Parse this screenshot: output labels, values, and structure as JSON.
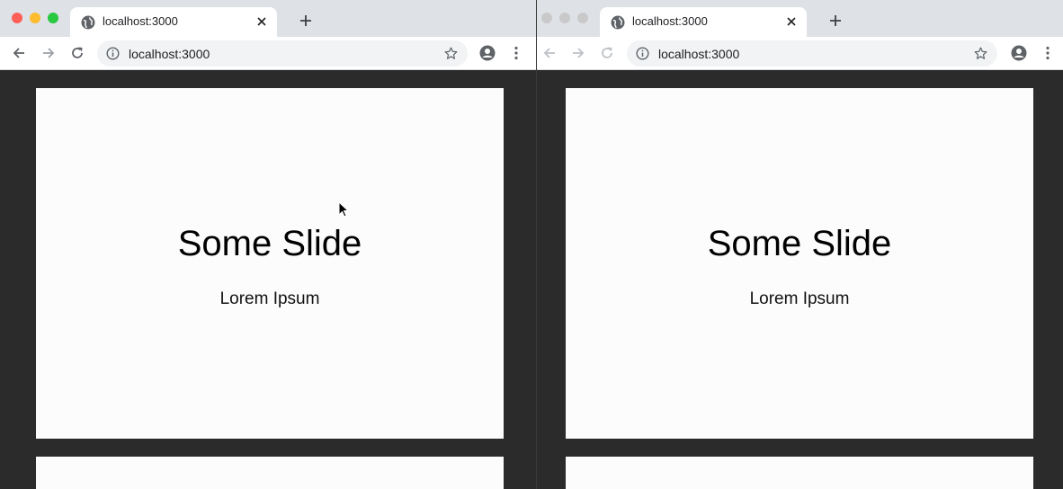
{
  "windows": [
    {
      "tab": {
        "title": "localhost:3000"
      },
      "address": {
        "url": "localhost:3000"
      },
      "slides": [
        {
          "title": "Some Slide",
          "subtitle": "Lorem Ipsum"
        },
        {
          "title": "",
          "subtitle": ""
        }
      ],
      "traffic_lights": [
        "#ff5f57",
        "#febc2e",
        "#28c840"
      ]
    },
    {
      "tab": {
        "title": "localhost:3000"
      },
      "address": {
        "url": "localhost:3000"
      },
      "slides": [
        {
          "title": "Some Slide",
          "subtitle": "Lorem Ipsum"
        },
        {
          "title": "",
          "subtitle": ""
        }
      ],
      "traffic_lights": [
        "#c9c9c9",
        "#c9c9c9",
        "#c9c9c9"
      ]
    }
  ],
  "colors": {
    "tabstrip": "#dee1e6",
    "background": "#2b2b2b",
    "slide": "#fcfcfc"
  },
  "icons": [
    "globe-icon",
    "close-icon",
    "plus-icon",
    "back-arrow-icon",
    "forward-arrow-icon",
    "reload-icon",
    "info-icon",
    "star-icon",
    "account-icon",
    "more-vert-icon",
    "mouse-cursor-icon"
  ]
}
